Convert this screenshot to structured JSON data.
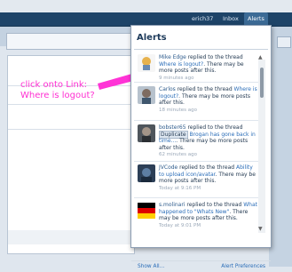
{
  "nav": {
    "username": "erich37",
    "inbox": "Inbox",
    "alerts": "Alerts"
  },
  "instruction": {
    "text": "click onto Link:\nWhere is logout?",
    "color": "#ff2fd2"
  },
  "popup": {
    "title": "Alerts",
    "footer_left": "Show All...",
    "footer_right": "Alert Preferences"
  },
  "alerts": [
    {
      "user": "Mike Edge",
      "action": " replied to the thread ",
      "thread": "Where is logout?",
      "suffix": ". There may be more posts after this.",
      "time": "9 minutes ago"
    },
    {
      "user": "Carlos",
      "action": " replied to the thread ",
      "thread": "Where is logout?",
      "suffix": ". There may be more posts after this.",
      "time": "18 minutes ago"
    },
    {
      "user": "bobster65",
      "action": " replied to the thread ",
      "tag": "Duplicate",
      "thread": " Brogan has gone back in time...",
      "suffix": ". There may be more posts after this.",
      "time": "62 minutes ago"
    },
    {
      "user": "JVCode",
      "action": " replied to the thread ",
      "thread": "Ability to upload icon/avatar",
      "suffix": ". There may be more posts after this.",
      "time": "Today at 9:16 PM"
    },
    {
      "user": "s.molinari",
      "action": " replied to the thread ",
      "thread": "What happened to \"Whats New\"",
      "suffix": ". There may be more posts after this.",
      "time": "Today at 9:01 PM"
    }
  ]
}
